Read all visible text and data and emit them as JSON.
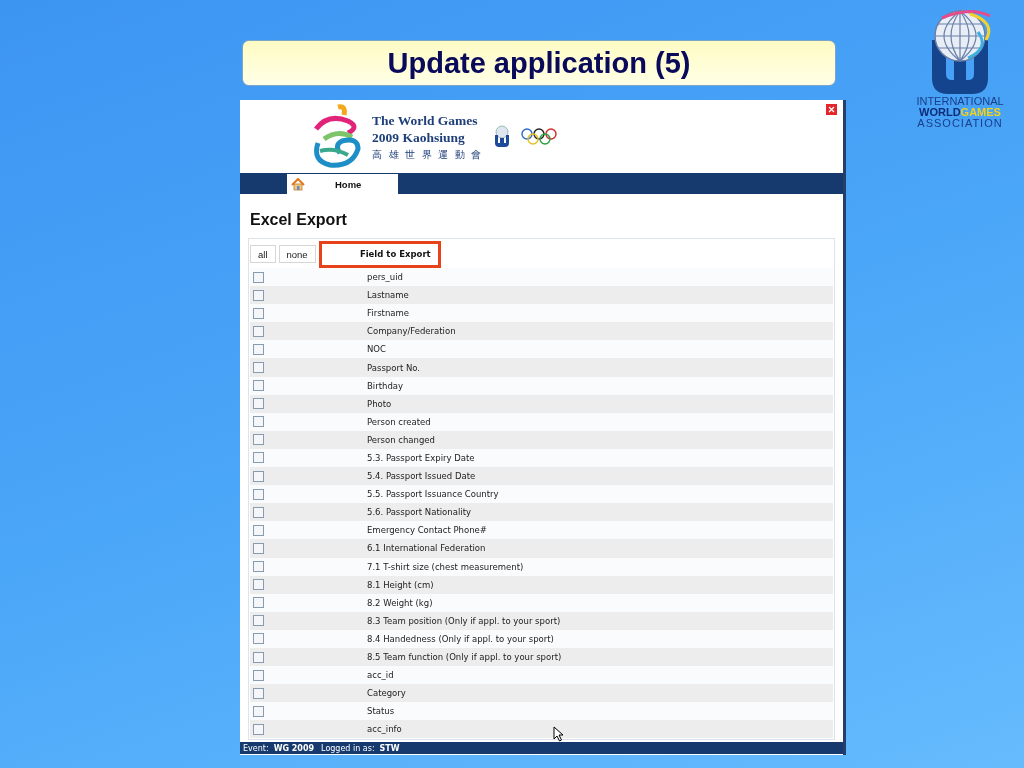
{
  "slide": {
    "title": "Update application (5)"
  },
  "association_logo": {
    "line_1": "INTERNATIONAL",
    "line_2a": "WORLD",
    "line_2b": "GAMES",
    "line_3": "ASSOCIATION"
  },
  "app": {
    "header": {
      "title_1": "The World Games",
      "title_2": "2009 Kaohsiung",
      "subtitle": "高雄世界運動會"
    },
    "nav": [
      {
        "label": "Home",
        "selected": true
      }
    ],
    "page_title": "Excel Export",
    "buttons": [
      "all",
      "none"
    ],
    "column_header": "Field to Export",
    "fields": [
      {
        "label": "pers_uid",
        "checked": false
      },
      {
        "label": "Lastname",
        "checked": false
      },
      {
        "label": "Firstname",
        "checked": false
      },
      {
        "label": "Company/Federation",
        "checked": false
      },
      {
        "label": "NOC",
        "checked": false
      },
      {
        "label": "Passport No.",
        "checked": false
      },
      {
        "label": "Birthday",
        "checked": false
      },
      {
        "label": "Photo",
        "checked": false
      },
      {
        "label": "Person created",
        "checked": false
      },
      {
        "label": "Person changed",
        "checked": false
      },
      {
        "label": "5.3. Passport Expiry Date",
        "checked": false
      },
      {
        "label": "5.4. Passport Issued Date",
        "checked": false
      },
      {
        "label": "5.5. Passport Issuance Country",
        "checked": false
      },
      {
        "label": "5.6. Passport Nationality",
        "checked": false
      },
      {
        "label": "Emergency Contact Phone#",
        "checked": false
      },
      {
        "label": "6.1 International Federation",
        "checked": false
      },
      {
        "label": "7.1 T-shirt size (chest measurement)",
        "checked": false
      },
      {
        "label": "8.1 Height (cm)",
        "checked": false
      },
      {
        "label": "8.2 Weight (kg)",
        "checked": false
      },
      {
        "label": "8.3 Team position (Only if appl. to your sport)",
        "checked": false
      },
      {
        "label": "8.4 Handedness (Only if appl. to your sport)",
        "checked": false
      },
      {
        "label": "8.5 Team function (Only if appl. to your sport)",
        "checked": false
      },
      {
        "label": "acc_id",
        "checked": false
      },
      {
        "label": "Category",
        "checked": false
      },
      {
        "label": "Status",
        "checked": false
      },
      {
        "label": "acc_info",
        "checked": false
      }
    ],
    "status_bar": {
      "event_label": "Event:",
      "event": "WG 2009",
      "user_label": "Logged in as:",
      "user": "STW"
    }
  }
}
